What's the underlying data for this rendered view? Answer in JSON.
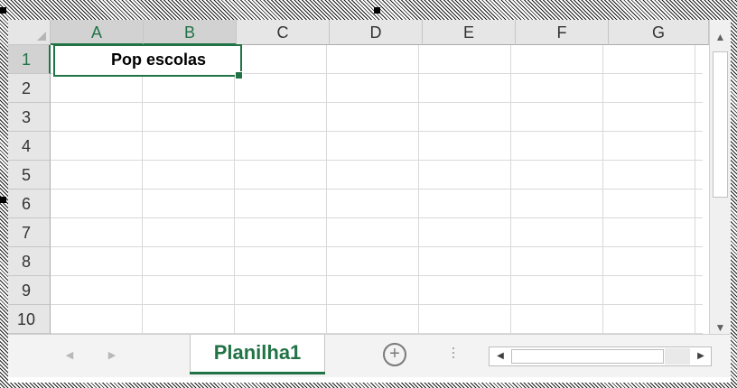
{
  "sheet": {
    "columns": [
      "A",
      "B",
      "C",
      "D",
      "E",
      "F",
      "G"
    ],
    "rows": [
      "1",
      "2",
      "3",
      "4",
      "5",
      "6",
      "7",
      "8",
      "9",
      "10"
    ],
    "selected_columns": [
      "A",
      "B"
    ],
    "selected_row": "1",
    "cell_A1": "Pop escolas",
    "accent_color": "#217346"
  },
  "tabs": {
    "active_label": "Planilha1",
    "prev_icon": "triangle-left-icon",
    "next_icon": "triangle-right-icon",
    "add_icon": "plus-circle-icon"
  },
  "scrollbars": {
    "up_icon": "triangle-up-icon",
    "down_icon": "triangle-down-icon",
    "left_icon": "triangle-left-icon",
    "right_icon": "triangle-right-icon"
  }
}
